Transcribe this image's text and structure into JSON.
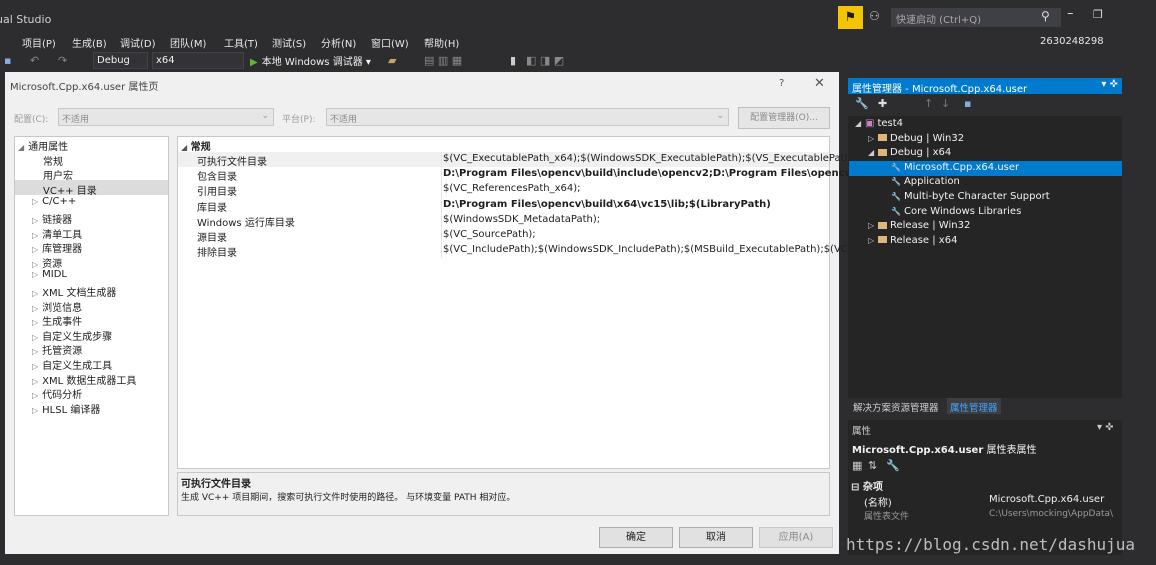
{
  "app": {
    "title": "ual Studio",
    "quick_launch": "快速启动 (Ctrl+Q)",
    "user": "2630248298"
  },
  "menu": [
    "项目(P)",
    "生成(B)",
    "调试(D)",
    "团队(M)",
    "工具(T)",
    "测试(S)",
    "分析(N)",
    "窗口(W)",
    "帮助(H)"
  ],
  "toolbar": {
    "config": "Debug",
    "platform": "x64",
    "run_label": "本地 Windows 调试器"
  },
  "dialog": {
    "title": "Microsoft.Cpp.x64.user 属性页",
    "help": "?",
    "close": "✕",
    "config_label": "配置(C):",
    "config_value": "不适用",
    "platform_label": "平台(P):",
    "platform_value": "不适用",
    "config_manager": "配置管理器(O)...",
    "tree": [
      {
        "label": "通用属性",
        "toggle": "◢",
        "level": 0
      },
      {
        "label": "常规",
        "toggle": "",
        "level": 1
      },
      {
        "label": "用户宏",
        "toggle": "",
        "level": 1
      },
      {
        "label": "VC++ 目录",
        "toggle": "",
        "level": 1
      },
      {
        "label": "C/C++",
        "toggle": "▷",
        "level": 1
      },
      {
        "label": "链接器",
        "toggle": "▷",
        "level": 1
      },
      {
        "label": "清单工具",
        "toggle": "▷",
        "level": 1
      },
      {
        "label": "库管理器",
        "toggle": "▷",
        "level": 1
      },
      {
        "label": "资源",
        "toggle": "▷",
        "level": 1
      },
      {
        "label": "MIDL",
        "toggle": "▷",
        "level": 1
      },
      {
        "label": "XML 文档生成器",
        "toggle": "▷",
        "level": 1
      },
      {
        "label": "浏览信息",
        "toggle": "▷",
        "level": 1
      },
      {
        "label": "生成事件",
        "toggle": "▷",
        "level": 1
      },
      {
        "label": "自定义生成步骤",
        "toggle": "▷",
        "level": 1
      },
      {
        "label": "托管资源",
        "toggle": "▷",
        "level": 1
      },
      {
        "label": "自定义生成工具",
        "toggle": "▷",
        "level": 1
      },
      {
        "label": "XML 数据生成器工具",
        "toggle": "▷",
        "level": 1
      },
      {
        "label": "代码分析",
        "toggle": "▷",
        "level": 1
      },
      {
        "label": "HLSL 编译器",
        "toggle": "▷",
        "level": 1
      }
    ],
    "grid_section": "常规",
    "grid": [
      {
        "name": "可执行文件目录",
        "value": "$(VC_ExecutablePath_x64);$(WindowsSDK_ExecutablePath);$(VS_ExecutablePath);",
        "bold": false
      },
      {
        "name": "包含目录",
        "value": "D:\\Program Files\\opencv\\build\\include\\opencv2;D:\\Program Files\\opencv\\build\\include;",
        "bold": true
      },
      {
        "name": "引用目录",
        "value": "$(VC_ReferencesPath_x64);",
        "bold": false
      },
      {
        "name": "库目录",
        "value": "D:\\Program Files\\opencv\\build\\x64\\vc15\\lib;$(LibraryPath)",
        "bold": true
      },
      {
        "name": "Windows 运行库目录",
        "value": "$(WindowsSDK_MetadataPath);",
        "bold": false
      },
      {
        "name": "源目录",
        "value": "$(VC_SourcePath);",
        "bold": false
      },
      {
        "name": "排除目录",
        "value": "$(VC_IncludePath);$(WindowsSDK_IncludePath);$(MSBuild_ExecutablePath);$(VC_LibraryPath_x64);",
        "bold": false
      }
    ],
    "desc_title": "可执行文件目录",
    "desc_text": "生成 VC++ 项目期间，搜索可执行文件时使用的路径。 与环境变量 PATH 相对应。",
    "ok": "确定",
    "cancel": "取消",
    "apply": "应用(A)"
  },
  "property_manager": {
    "title": "属性管理器 - Microsoft.Cpp.x64.user",
    "tree": [
      {
        "label": "test4",
        "toggle": "◢",
        "level": 0,
        "icon": "project"
      },
      {
        "label": "Debug | Win32",
        "toggle": "▷",
        "level": 1,
        "icon": "folder"
      },
      {
        "label": "Debug | x64",
        "toggle": "◢",
        "level": 1,
        "icon": "folder"
      },
      {
        "label": "Microsoft.Cpp.x64.user",
        "toggle": "",
        "level": 2,
        "icon": "wrench"
      },
      {
        "label": "Application",
        "toggle": "",
        "level": 2,
        "icon": "wrench"
      },
      {
        "label": "Multi-byte Character Support",
        "toggle": "",
        "level": 2,
        "icon": "wrench"
      },
      {
        "label": "Core Windows Libraries",
        "toggle": "",
        "level": 2,
        "icon": "wrench"
      },
      {
        "label": "Release | Win32",
        "toggle": "▷",
        "level": 1,
        "icon": "folder"
      },
      {
        "label": "Release | x64",
        "toggle": "▷",
        "level": 1,
        "icon": "folder"
      }
    ],
    "tab_solution": "解决方案资源管理器",
    "tab_property": "属性管理器"
  },
  "properties": {
    "title": "属性",
    "object": "Microsoft.Cpp.x64.user",
    "object_type": "属性表属性",
    "category": "杂项",
    "rows": [
      {
        "name": "(名称)",
        "value": "Microsoft.Cpp.x64.user"
      },
      {
        "name": "属性表文件",
        "value": "C:\\Users\\mocking\\AppData\\"
      }
    ]
  },
  "watermark": "https://blog.csdn.net/dashujua",
  "colors": {
    "accent": "#007acc",
    "notification": "#f5c400",
    "ide_bg": "#2d2d30",
    "panel_bg": "#252526"
  }
}
